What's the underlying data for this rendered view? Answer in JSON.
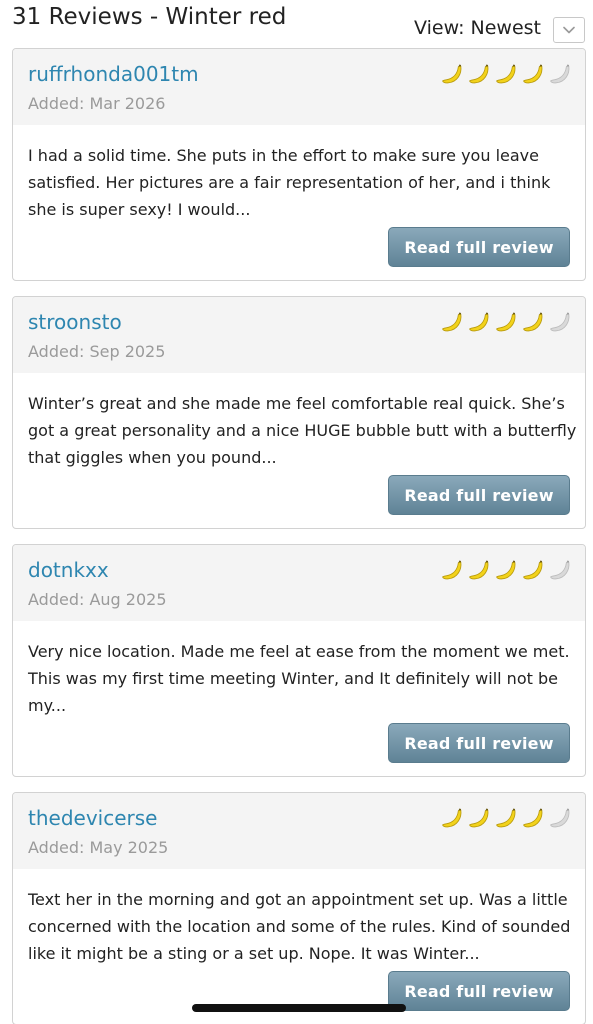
{
  "header": {
    "title": "31 Reviews - Winter red",
    "sort_label": "View: Newest",
    "sort_icon": "chevron-down-icon"
  },
  "rating_max": 5,
  "rating_icon": "banana-icon",
  "colors": {
    "accent_link": "#2e86b0",
    "banana_filled": "#f2d21b",
    "banana_empty": "#d9d9d9",
    "button": "#6f90a2"
  },
  "reviews": [
    {
      "reviewer": "ruffrhonda001tm",
      "added": "Added: Mar 2026",
      "rating": 4,
      "excerpt": "I had a solid time. She puts in the effort to make sure you leave satisfied. Her pictures are a fair representation of her, and i think she is super sexy! I would...",
      "button_label": "Read full review"
    },
    {
      "reviewer": "stroonsto",
      "added": "Added: Sep 2025",
      "rating": 4,
      "excerpt": "Winter’s great and she made me feel comfortable real quick. She’s got a great personality and a nice HUGE bubble butt with a butterfly that giggles when you pound...",
      "button_label": "Read full review"
    },
    {
      "reviewer": "dotnkxx",
      "added": "Added: Aug 2025",
      "rating": 4,
      "excerpt": "Very nice location. Made me feel at ease from the moment we met. This was my first time meeting Winter, and It definitely will not be my...",
      "button_label": "Read full review"
    },
    {
      "reviewer": "thedevicerse",
      "added": "Added: May 2025",
      "rating": 4,
      "excerpt": "Text her in the morning and got an appointment set up. Was a little concerned with the location and some of the rules. Kind of sounded like it might be a sting or a set up. Nope. It was Winter...",
      "button_label": "Read full review"
    }
  ]
}
